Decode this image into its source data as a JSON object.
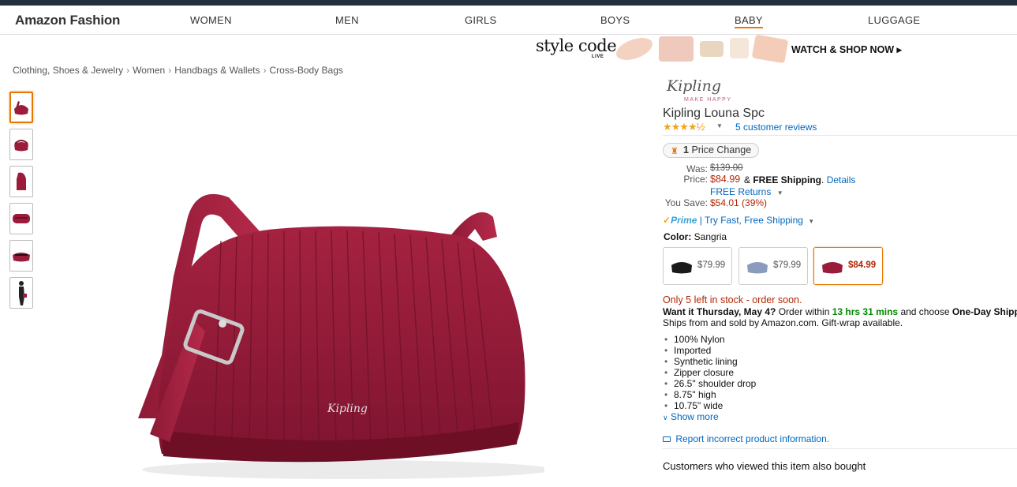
{
  "nav": {
    "brand": "Amazon Fashion",
    "links": [
      "WOMEN",
      "MEN",
      "GIRLS",
      "BOYS",
      "BABY",
      "LUGGAGE"
    ]
  },
  "banner": {
    "logo": "style code",
    "logo_sub": "LIVE",
    "cta": "WATCH & SHOP NOW ▸"
  },
  "breadcrumb": [
    "Clothing, Shoes & Jewelry",
    "Women",
    "Handbags & Wallets",
    "Cross-Body Bags"
  ],
  "breadcrumb_sep": "›",
  "product": {
    "brand_logo": "Kipling",
    "brand_tagline": "MAKE HAPPY",
    "title": "Kipling Louna Spc",
    "stars": "★★★★½",
    "rating": 4.5,
    "reviews": "5 customer reviews",
    "price_change": "Price Change",
    "price_change_count": "1",
    "was_label": "Was:",
    "was": "$139.00",
    "price_label": "Price:",
    "price": "$84.99",
    "shipping_prefix": "& ",
    "shipping_bold": "FREE Shipping",
    "shipping_suffix": ".",
    "details": "Details",
    "returns": "FREE Returns",
    "save_label": "You Save:",
    "save": "$54.01 (39%)",
    "prime_logo": "Prime",
    "prime_text": "| Try Fast, Free Shipping",
    "color_label": "Color:",
    "color_value": "Sangria",
    "swatches": [
      {
        "price": "$79.99",
        "color": "#1a1a1a"
      },
      {
        "price": "$79.99",
        "color": "#8a9bbd"
      },
      {
        "price": "$84.99",
        "color": "#9b1b3a"
      }
    ],
    "stock": "Only 5 left in stock - order soon.",
    "delivery_bold": "Want it Thursday, May 4?",
    "delivery_mid": " Order within ",
    "delivery_countdown": "13 hrs 31 mins",
    "delivery_end": " and choose ",
    "delivery_option": "One-Day Shipping",
    "ships_from": "Ships from and sold by Amazon.com. Gift-wrap available.",
    "features": [
      "100% Nylon",
      "Imported",
      "Synthetic lining",
      "Zipper closure",
      "26.5\" shoulder drop",
      "8.75\" high",
      "10.75\" wide"
    ],
    "show_more": "Show more",
    "report": "Report incorrect product information.",
    "also_bought": "Customers who viewed this item also bought"
  },
  "colors": {
    "accent": "#e47911",
    "link": "#0066c0",
    "price": "#b12704",
    "bag": "#9b1b3a"
  }
}
